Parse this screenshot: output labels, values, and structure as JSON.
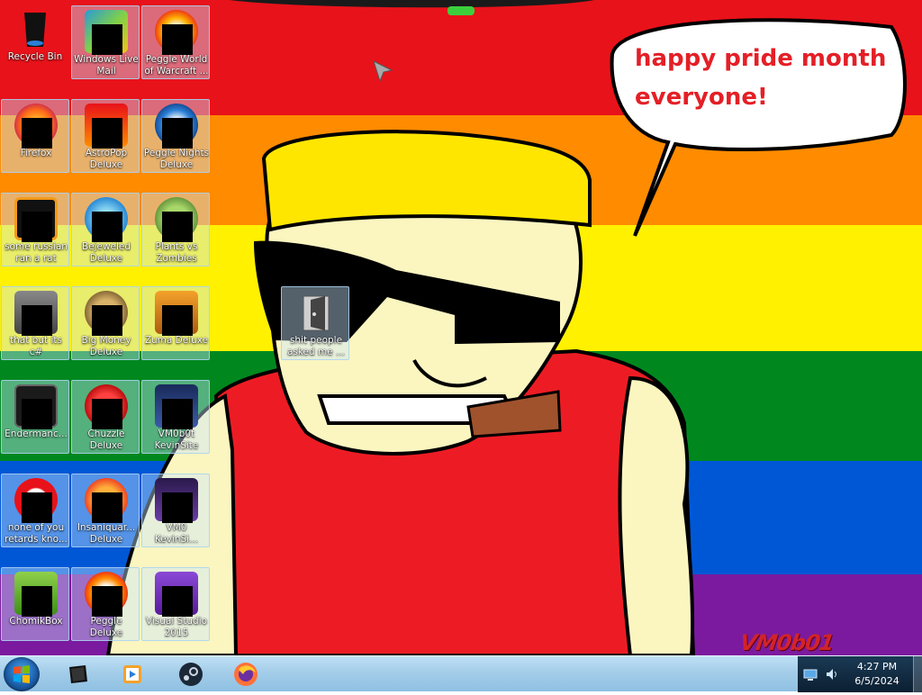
{
  "wallpaper": {
    "stripe_colors": [
      "#e8121a",
      "#ff8b00",
      "#fff100",
      "#00881f",
      "#0057d6",
      "#7b1a9e"
    ],
    "speech_bubble": [
      "happy pride month",
      "everyone!"
    ],
    "signature": "VM0b01"
  },
  "desktop_icons": [
    {
      "label": "Recycle Bin",
      "icon": "recycle-bin-icon",
      "redacted": false
    },
    {
      "label": "Windows Live Mail",
      "icon": "windows-live-mail-icon",
      "redacted": true
    },
    {
      "label": "Peggle World of Warcraft ...",
      "icon": "peggle-wow-icon",
      "redacted": true
    },
    {
      "label": "Firefox",
      "icon": "firefox-icon",
      "redacted": true
    },
    {
      "label": "AstroPop Deluxe",
      "icon": "astropop-icon",
      "redacted": true
    },
    {
      "label": "Peggle Nights Deluxe",
      "icon": "peggle-nights-icon",
      "redacted": true
    },
    {
      "label": "some russian ran a rat",
      "icon": "rat-app-icon",
      "redacted": true
    },
    {
      "label": "Bejeweled Deluxe",
      "icon": "bejeweled-icon",
      "redacted": true
    },
    {
      "label": "Plants vs Zombies",
      "icon": "plants-vs-zombies-icon",
      "redacted": true
    },
    {
      "label": "that but its c#",
      "icon": "program-icon",
      "redacted": true
    },
    {
      "label": "Big Money Deluxe",
      "icon": "big-money-icon",
      "redacted": true
    },
    {
      "label": "Zuma Deluxe",
      "icon": "zuma-icon",
      "redacted": true
    },
    {
      "label": "Endermanc...",
      "icon": "console-app-icon",
      "redacted": true
    },
    {
      "label": "Chuzzle Deluxe",
      "icon": "chuzzle-icon",
      "redacted": true
    },
    {
      "label": "VM0b0t KevinSite",
      "icon": "kevinsite-icon",
      "redacted": true
    },
    {
      "label": "none of you retards kno...",
      "icon": "red-circle-icon",
      "redacted": true
    },
    {
      "label": "Insaniquar... Deluxe",
      "icon": "insaniquarium-icon",
      "redacted": true
    },
    {
      "label": "VM0 KevinSi...",
      "icon": "kevinsite-icon",
      "redacted": true
    },
    {
      "label": "ChomikBox",
      "icon": "chomikbox-icon",
      "redacted": true
    },
    {
      "label": "Peggle Deluxe",
      "icon": "peggle-icon",
      "redacted": true
    },
    {
      "label": "Visual Studio 2015",
      "icon": "visual-studio-icon",
      "redacted": true
    },
    {
      "label": "shit people asked me ...",
      "icon": "folder-icon",
      "redacted": false
    }
  ],
  "taskbar": {
    "start": "windows-start-orb-icon",
    "pinned": [
      {
        "icon": "computer-icon"
      },
      {
        "icon": "media-player-icon"
      },
      {
        "icon": "steam-icon"
      },
      {
        "icon": "firefox-icon"
      }
    ],
    "tray": [
      {
        "icon": "network-icon"
      },
      {
        "icon": "volume-icon"
      }
    ],
    "clock": {
      "time": "4:27 PM",
      "date": "6/5/2024"
    }
  }
}
